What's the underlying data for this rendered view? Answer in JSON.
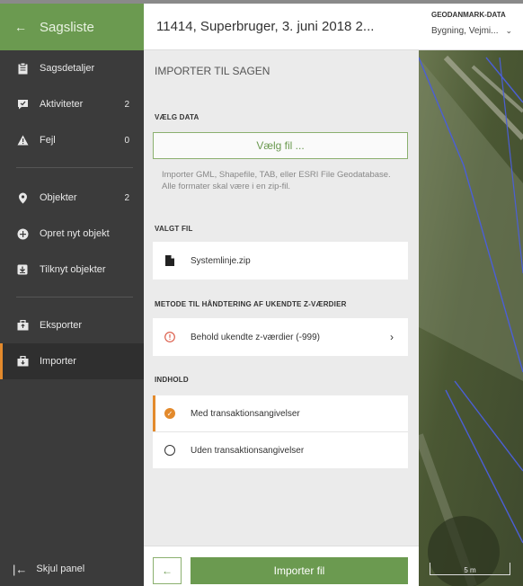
{
  "sidebar": {
    "header": {
      "title": "Sagsliste"
    },
    "items": [
      {
        "label": "Sagsdetaljer",
        "count": ""
      },
      {
        "label": "Aktiviteter",
        "count": "2"
      },
      {
        "label": "Fejl",
        "count": "0"
      },
      {
        "label": "Objekter",
        "count": "2"
      },
      {
        "label": "Opret nyt objekt",
        "count": ""
      },
      {
        "label": "Tilknyt objekter",
        "count": ""
      },
      {
        "label": "Eksporter",
        "count": ""
      },
      {
        "label": "Importer",
        "count": ""
      }
    ],
    "footer_label": "Skjul panel"
  },
  "panel": {
    "header_title": "11414, Superbruger, 3. juni 2018 2...",
    "section_title": "IMPORTER TIL SAGEN",
    "choose_data": {
      "label": "VÆLG DATA",
      "button": "Vælg fil ...",
      "help": "Importer GML, Shapefile, TAB, eller ESRI File Geodatabase. Alle formater skal være i en zip-fil."
    },
    "selected_file": {
      "label": "VALGT FIL",
      "name": "Systemlinje.zip"
    },
    "method": {
      "label": "METODE TIL HÅNDTERING AF UKENDTE Z-VÆRDIER",
      "value": "Behold ukendte z-værdier (-999)"
    },
    "content": {
      "label": "INDHOLD",
      "options": [
        {
          "label": "Med transaktionsangivelser"
        },
        {
          "label": "Uden transaktionsangivelser"
        }
      ]
    },
    "import_button": "Importer fil"
  },
  "map": {
    "header_title": "GEODANMARK-DATA",
    "layer": "Bygning, Vejmi...",
    "scale": "5 m"
  },
  "colors": {
    "accent": "#6b9a50",
    "selected": "#e38a2c",
    "sidebar": "#3b3b3b"
  }
}
